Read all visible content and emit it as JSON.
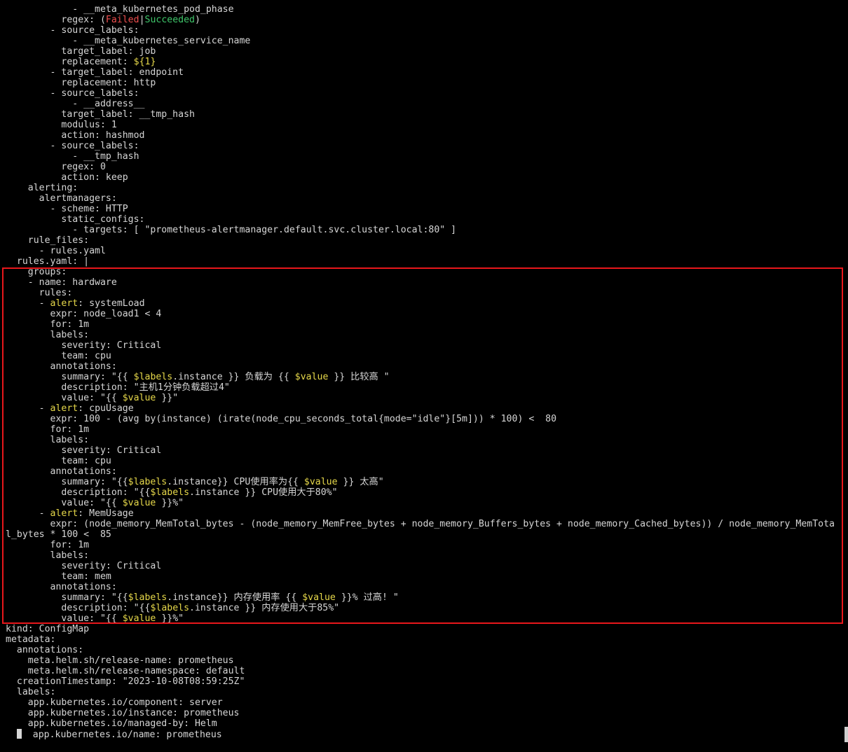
{
  "terminal": {
    "lines": [
      "            - __meta_kubernetes_pod_phase",
      "          regex: (Failed|Succeeded)",
      "        - source_labels:",
      "            - __meta_kubernetes_service_name",
      "          target_label: job",
      "          replacement: ${1}",
      "        - target_label: endpoint",
      "          replacement: http",
      "        - source_labels:",
      "            - __address__",
      "          target_label: __tmp_hash",
      "          modulus: 1",
      "          action: hashmod",
      "        - source_labels:",
      "            - __tmp_hash",
      "          regex: 0",
      "          action: keep",
      "    alerting:",
      "      alertmanagers:",
      "        - scheme: HTTP",
      "          static_configs:",
      "            - targets: [ \"prometheus-alertmanager.default.svc.cluster.local:80\" ]",
      "    rule_files:",
      "      - rules.yaml",
      "  rules.yaml: |",
      "    groups:",
      "    - name: hardware",
      "      rules:",
      "      - alert: systemLoad",
      "        expr: node_load1 < 4",
      "        for: 1m",
      "        labels:",
      "          severity: Critical",
      "          team: cpu",
      "        annotations:",
      "          summary: \"{{ $labels.instance }} 负载为 {{ $value }} 比较高 \"",
      "          description: \"主机1分钟负载超过4\"",
      "          value: \"{{ $value }}\"",
      "      - alert: cpuUsage",
      "        expr: 100 - (avg by(instance) (irate(node_cpu_seconds_total{mode=\"idle\"}[5m])) * 100) <  80",
      "        for: 1m",
      "        labels:",
      "          severity: Critical",
      "          team: cpu",
      "        annotations:",
      "          summary: \"{{$labels.instance}} CPU使用率为{{ $value }} 太高\"",
      "          description: \"{{$labels.instance }} CPU使用大于80%\"",
      "          value: \"{{ $value }}%\"",
      "      - alert: MemUsage",
      "        expr: (node_memory_MemTotal_bytes - (node_memory_MemFree_bytes + node_memory_Buffers_bytes + node_memory_Cached_bytes)) / node_memory_MemTota",
      "l_bytes * 100 <  85",
      "        for: 1m",
      "        labels:",
      "          severity: Critical",
      "          team: mem",
      "        annotations:",
      "          summary: \"{{$labels.instance}} 内存使用率 {{ $value }}% 过高! \"",
      "          description: \"{{$labels.instance }} 内存使用大于85%\"",
      "          value: \"{{ $value }}%\"",
      "kind: ConfigMap",
      "metadata:",
      "  annotations:",
      "    meta.helm.sh/release-name: prometheus",
      "    meta.helm.sh/release-namespace: default",
      "  creationTimestamp: \"2023-10-08T08:59:25Z\"",
      "  labels:",
      "    app.kubernetes.io/component: server",
      "    app.kubernetes.io/instance: prometheus",
      "    app.kubernetes.io/managed-by: Helm",
      "    app.kubernetes.io/name: prometheus"
    ]
  },
  "colors": {
    "background": "#000000",
    "text": "#d6d6d6",
    "failed": "#ef4f4f",
    "succeeded": "#3fc66a",
    "variable": "#e6d84a",
    "highlight_border": "#e8171b"
  }
}
